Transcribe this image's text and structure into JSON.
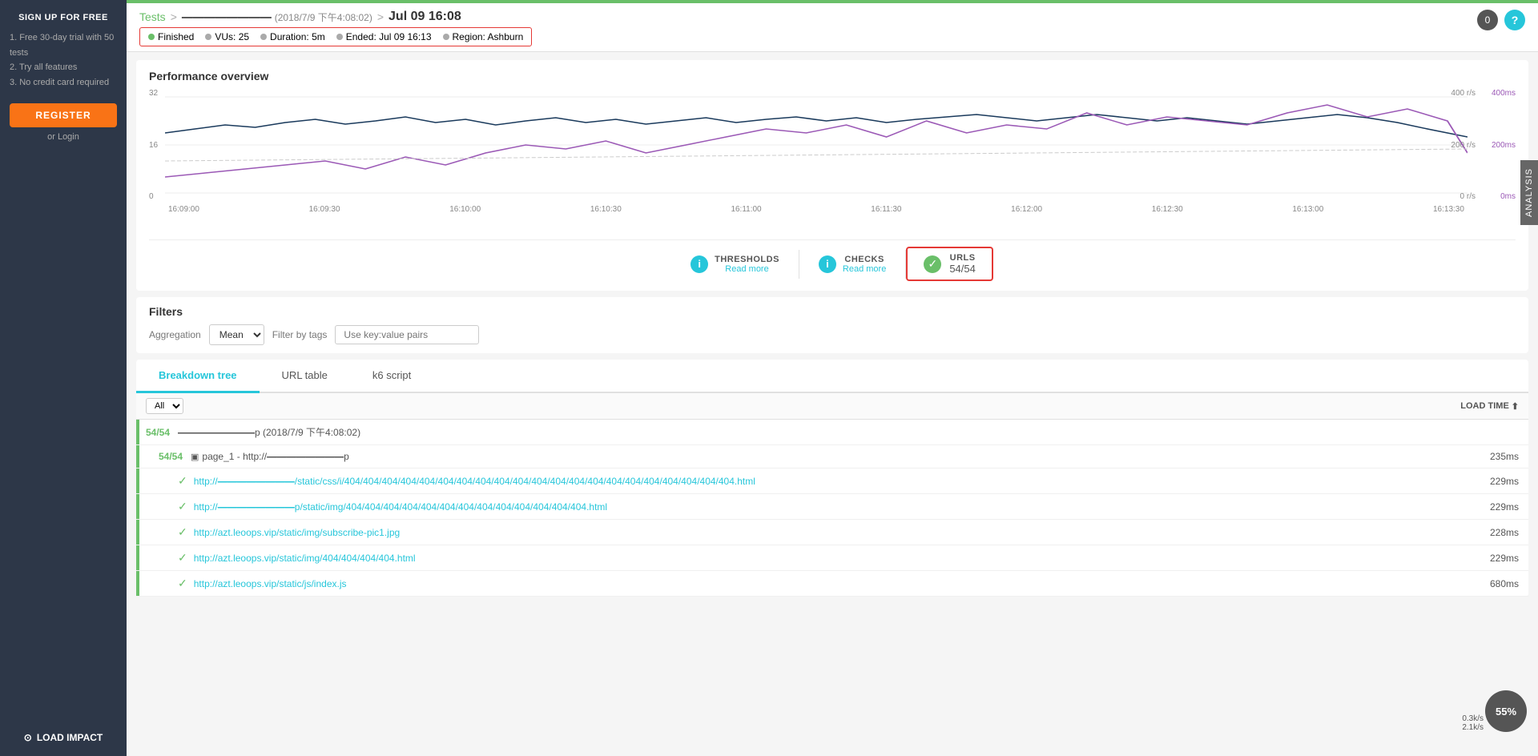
{
  "sidebar": {
    "signup_label": "SIGN UP FOR FREE",
    "list_items": [
      "1. Free 30-day trial with 50 tests",
      "2. Try all features",
      "3. No credit card required"
    ],
    "register_label": "REGISTER",
    "login_label": "or Login",
    "logo_label": "LOAD IMPACT"
  },
  "header": {
    "breadcrumb_tests": "Tests",
    "breadcrumb_test_name": "————————",
    "breadcrumb_date": "(2018/7/9 下午4:08:02)",
    "breadcrumb_separator": ">",
    "page_title": "Jul 09 16:08"
  },
  "status_bar": {
    "finished_label": "Finished",
    "vus_label": "VUs: 25",
    "duration_label": "Duration: 5m",
    "ended_label": "Ended: Jul 09 16:13",
    "region_label": "Region: Ashburn"
  },
  "performance": {
    "title": "Performance overview",
    "y_left": [
      "32",
      "16",
      "0"
    ],
    "y_right": [
      "400ms",
      "200ms",
      "0ms"
    ],
    "y_right2": [
      "400 r/s",
      "200 r/s",
      "0 r/s"
    ],
    "x_labels": [
      "16:09:00",
      "16:09:30",
      "16:10:00",
      "16:10:30",
      "16:11:00",
      "16:11:30",
      "16:12:00",
      "16:12:30",
      "16:13:00",
      "16:13:30"
    ]
  },
  "metrics": {
    "thresholds_label": "THRESHOLDS",
    "thresholds_sub": "Read more",
    "checks_label": "CHECKS",
    "checks_sub": "Read more",
    "urls_label": "URLS",
    "urls_value": "54/54"
  },
  "filters": {
    "title": "Filters",
    "aggregation_label": "Aggregation",
    "aggregation_value": "Mean",
    "tags_label": "Filter by tags",
    "tags_placeholder": "Use key:value pairs"
  },
  "tabs": [
    {
      "label": "Breakdown tree",
      "active": true
    },
    {
      "label": "URL table",
      "active": false
    },
    {
      "label": "k6 script",
      "active": false
    }
  ],
  "table": {
    "all_label": "All",
    "load_time_label": "LOAD TIME",
    "rows": [
      {
        "badge": "54/54",
        "indent": 0,
        "text": "————————p (2018/7/9 下午4:08:02)",
        "time": "",
        "type": "parent",
        "checked": false
      },
      {
        "badge": "54/54",
        "indent": 1,
        "text": "page_1 - http://————————p",
        "time": "235ms",
        "type": "page",
        "checked": false
      },
      {
        "badge": "",
        "indent": 2,
        "text": "http://————————/static/css/i/404/404/404/404/404/404/404/404/404/404/404/404/404/404/404/404/404/404/404/404/404.html",
        "time": "229ms",
        "type": "url",
        "checked": true
      },
      {
        "badge": "",
        "indent": 2,
        "text": "http://————————p/static/img/404/404/404/404/404/404/404/404/404/404/404/404/404.html",
        "time": "229ms",
        "type": "url",
        "checked": true
      },
      {
        "badge": "",
        "indent": 2,
        "text": "http://azt.leoops.vip/static/img/subscribe-pic1.jpg",
        "time": "228ms",
        "type": "url",
        "checked": true
      },
      {
        "badge": "",
        "indent": 2,
        "text": "http://azt.leoops.vip/static/img/404/404/404/404.html",
        "time": "229ms",
        "type": "url",
        "checked": true
      },
      {
        "badge": "",
        "indent": 2,
        "text": "http://azt.leoops.vip/static/js/index.js",
        "time": "680ms",
        "type": "url",
        "checked": true
      }
    ]
  },
  "right_panel": {
    "analysis_label": "ANALYSIS"
  },
  "speed": {
    "value": "55%",
    "down": "0.3k/s",
    "up": "2.1k/s"
  },
  "help": {
    "label": "?"
  }
}
